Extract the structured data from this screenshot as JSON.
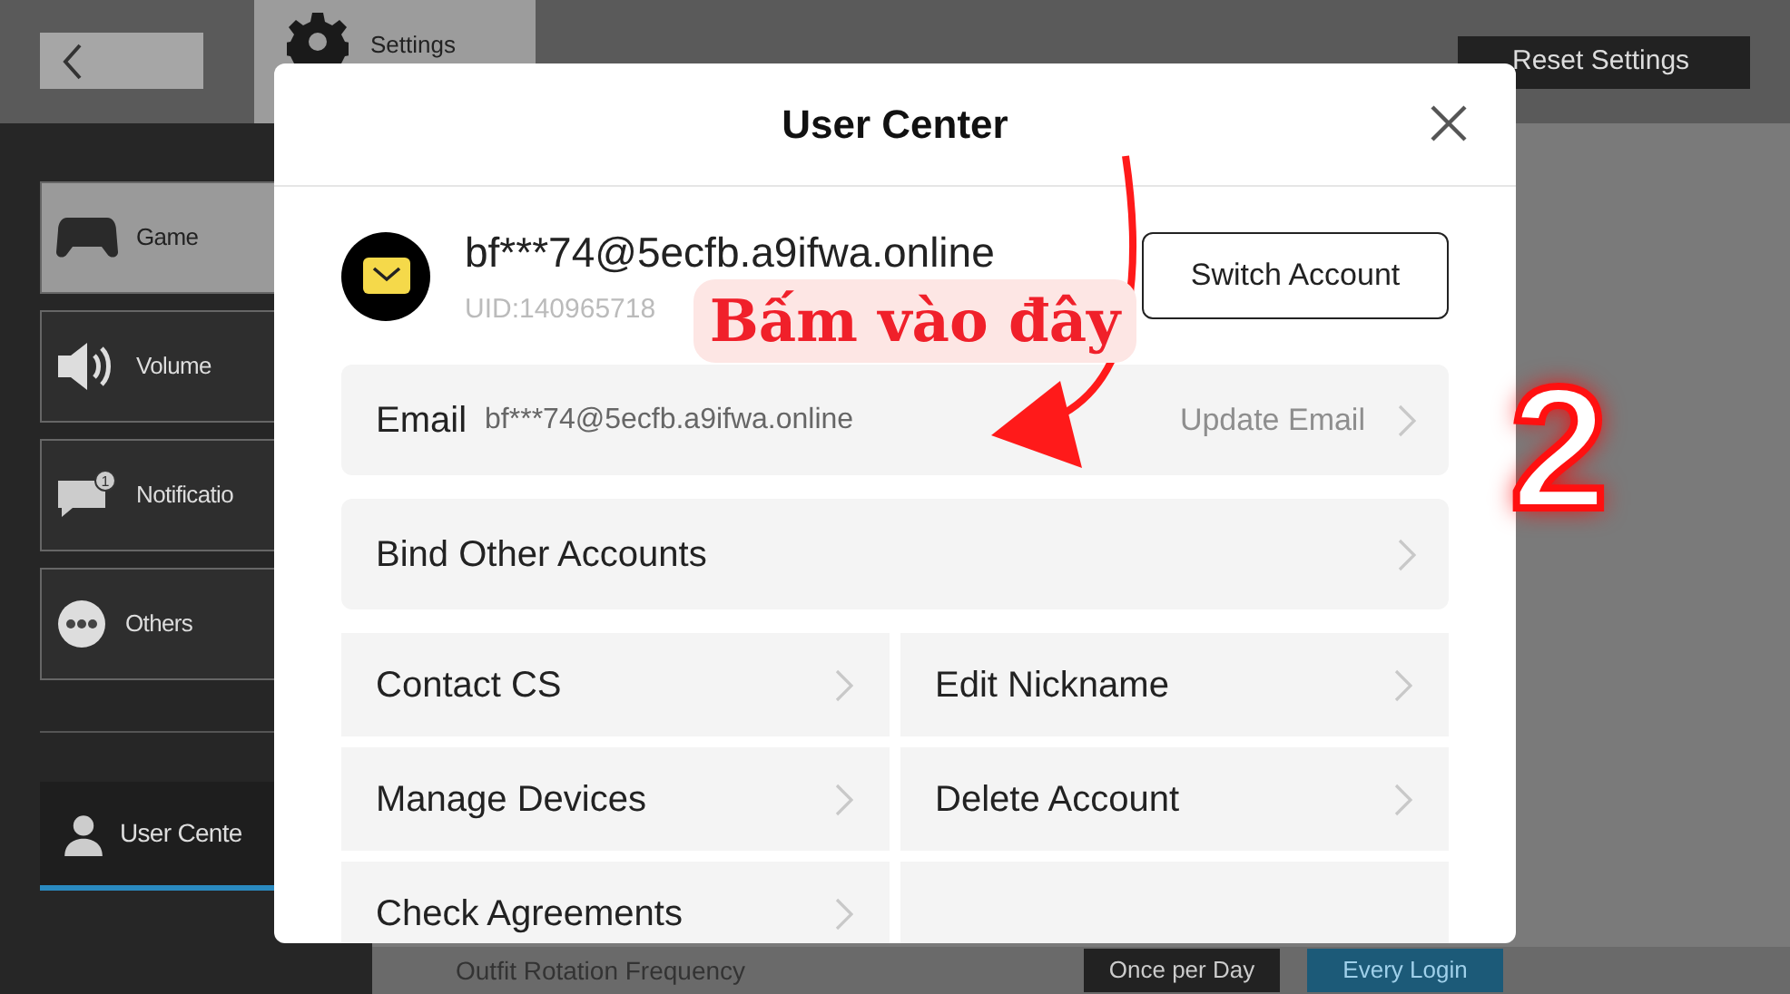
{
  "top_bar": {
    "settings_tab": "Settings",
    "reset_button": "Reset Settings"
  },
  "sidebar": {
    "items": [
      {
        "kind": "gamepad",
        "label": "Game",
        "selected": true
      },
      {
        "kind": "speaker",
        "label": "Volume",
        "selected": false
      },
      {
        "kind": "message",
        "label": "Notificatio",
        "badge": "1",
        "selected": false
      },
      {
        "kind": "dots",
        "label": "Others",
        "selected": false
      }
    ],
    "account_tab": {
      "label": "User Cente",
      "active": true
    }
  },
  "bottom_row": {
    "label": "Outfit Rotation Frequency",
    "options": [
      {
        "label": "Once per Day",
        "selected": false
      },
      {
        "label": "Every Login",
        "selected": true
      }
    ]
  },
  "dialog": {
    "title": "User Center",
    "account": {
      "name": "bf***74@5ecfb.a9ifwa.online",
      "uid": "UID:140965718"
    },
    "switch_button": "Switch Account",
    "email_row": {
      "label": "Email",
      "value": "bf***74@5ecfb.a9ifwa.online",
      "action": "Update Email"
    },
    "bind_row": "Bind Other Accounts",
    "grid": [
      "Contact CS",
      "Edit Nickname",
      "Manage Devices",
      "Delete Account",
      "Check Agreements"
    ]
  },
  "annotation": {
    "callout": "Bấm vào đây",
    "step": "2"
  }
}
